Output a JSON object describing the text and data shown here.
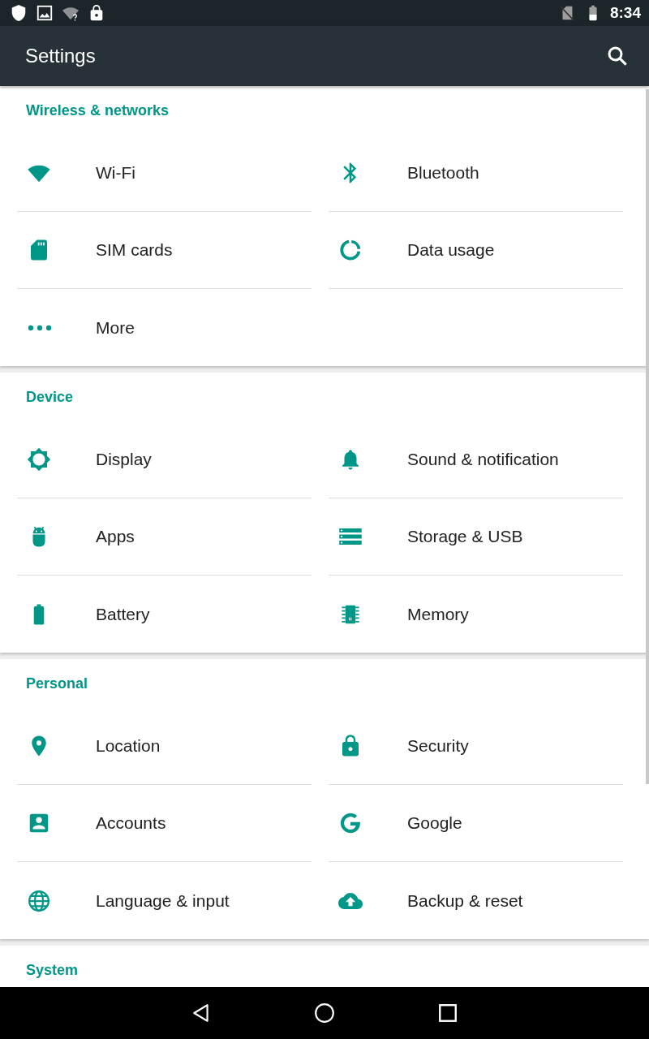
{
  "status_bar": {
    "time": "8:34"
  },
  "app_bar": {
    "title": "Settings"
  },
  "sections": [
    {
      "title": "Wireless & networks",
      "items": [
        {
          "label": "Wi-Fi"
        },
        {
          "label": "Bluetooth"
        },
        {
          "label": "SIM cards"
        },
        {
          "label": "Data usage"
        },
        {
          "label": "More"
        }
      ]
    },
    {
      "title": "Device",
      "items": [
        {
          "label": "Display"
        },
        {
          "label": "Sound & notification"
        },
        {
          "label": "Apps"
        },
        {
          "label": "Storage & USB"
        },
        {
          "label": "Battery"
        },
        {
          "label": "Memory"
        }
      ]
    },
    {
      "title": "Personal",
      "items": [
        {
          "label": "Location"
        },
        {
          "label": "Security"
        },
        {
          "label": "Accounts"
        },
        {
          "label": "Google"
        },
        {
          "label": "Language & input"
        },
        {
          "label": "Backup & reset"
        }
      ]
    },
    {
      "title": "System"
    }
  ]
}
